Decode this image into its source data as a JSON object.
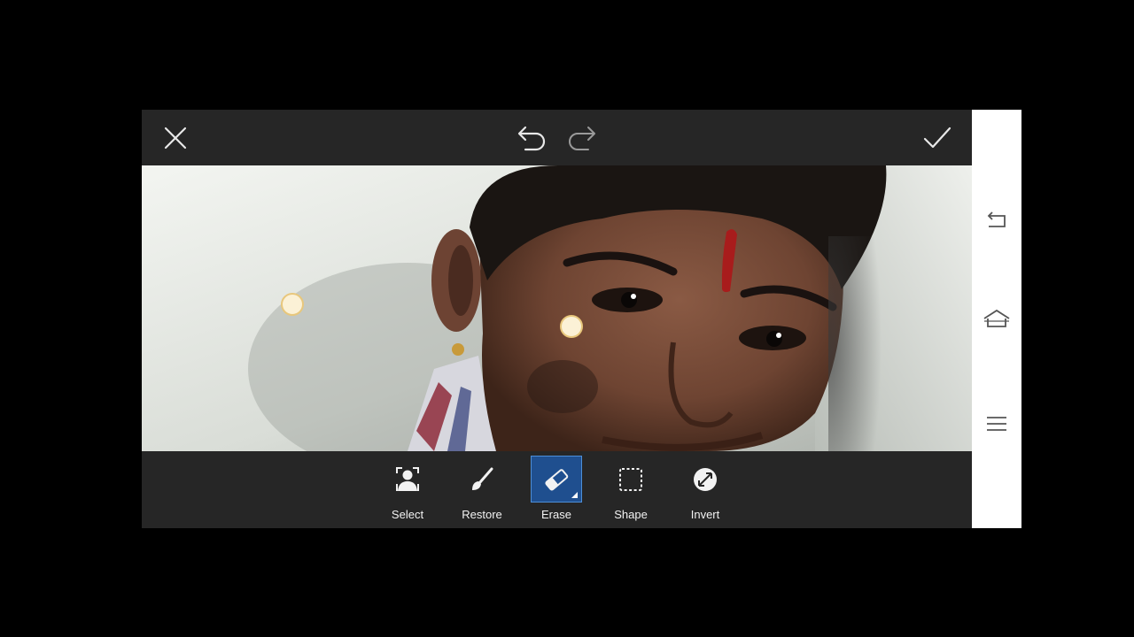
{
  "topbar": {
    "close_icon": "close-icon",
    "undo_icon": "undo-icon",
    "redo_icon": "redo-icon",
    "apply_icon": "checkmark-icon"
  },
  "canvas": {
    "content": "portrait photo with eraser brush markers",
    "brush_markers": 2
  },
  "toolbar": {
    "tools": [
      {
        "label": "Select",
        "icon": "person-select-icon",
        "active": false
      },
      {
        "label": "Restore",
        "icon": "brush-icon",
        "active": false
      },
      {
        "label": "Erase",
        "icon": "eraser-icon",
        "active": true
      },
      {
        "label": "Shape",
        "icon": "dashed-square-icon",
        "active": false
      },
      {
        "label": "Invert",
        "icon": "invert-icon",
        "active": false
      }
    ]
  },
  "navbar": {
    "back_icon": "back-icon",
    "home_icon": "home-icon",
    "menu_icon": "menu-icon"
  },
  "colors": {
    "app_bg": "#262626",
    "active_tool": "#1f4f8f",
    "navbar_bg": "#ffffff"
  }
}
